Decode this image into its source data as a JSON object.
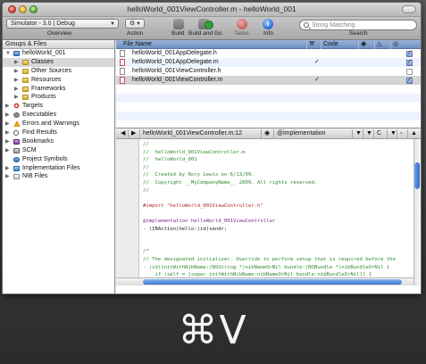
{
  "window": {
    "title": "helloWorld_001ViewController.m - helloWorld_001"
  },
  "toolbar": {
    "overview_value": "Simulator - 3.0 | Debug",
    "overview_label": "Overview",
    "action_label": "Action",
    "build_label": "Build",
    "build_go_label": "Build and Go",
    "tasks_label": "Tasks",
    "info_label": "Info",
    "info_glyph": "i",
    "search_placeholder": "String Matching",
    "search_label": "Search"
  },
  "sidebar": {
    "header": "Groups & Files",
    "items": [
      {
        "label": "helloWorld_001",
        "icon": "project-icon",
        "indent": 0,
        "expanded": true,
        "selected": false
      },
      {
        "label": "Classes",
        "icon": "folder-icon",
        "indent": 1,
        "expanded": false,
        "selected": true
      },
      {
        "label": "Other Sources",
        "icon": "folder-icon",
        "indent": 1,
        "expanded": false,
        "selected": false
      },
      {
        "label": "Resources",
        "icon": "folder-icon",
        "indent": 1,
        "expanded": false,
        "selected": false
      },
      {
        "label": "Frameworks",
        "icon": "folder-icon",
        "indent": 1,
        "expanded": false,
        "selected": false
      },
      {
        "label": "Products",
        "icon": "folder-icon",
        "indent": 1,
        "expanded": false,
        "selected": false
      },
      {
        "label": "Targets",
        "icon": "target-icon",
        "indent": 0,
        "expanded": false,
        "selected": false
      },
      {
        "label": "Executables",
        "icon": "gear-icon",
        "indent": 0,
        "expanded": false,
        "selected": false
      },
      {
        "label": "Errors and Warnings",
        "icon": "warning-icon",
        "indent": 0,
        "expanded": false,
        "selected": false
      },
      {
        "label": "Find Results",
        "icon": "find-icon",
        "indent": 0,
        "expanded": false,
        "selected": false
      },
      {
        "label": "Bookmarks",
        "icon": "bookmark-icon",
        "indent": 0,
        "expanded": false,
        "selected": false
      },
      {
        "label": "SCM",
        "icon": "scm-icon",
        "indent": 0,
        "expanded": false,
        "selected": false
      },
      {
        "label": "Project Symbols",
        "icon": "symbols-icon",
        "indent": 0,
        "expanded": null,
        "selected": false
      },
      {
        "label": "Implementation Files",
        "icon": "implementation-icon",
        "indent": 0,
        "expanded": false,
        "selected": false
      },
      {
        "label": "NIB Files",
        "icon": "nib-icon",
        "indent": 0,
        "expanded": false,
        "selected": false
      }
    ]
  },
  "detail": {
    "columns": [
      "File Name",
      "Code"
    ],
    "files": [
      {
        "name": "helloWorld_001AppDelegate.h",
        "code": false,
        "checked": true
      },
      {
        "name": "helloWorld_001AppDelegate.m",
        "code": true,
        "checked": true
      },
      {
        "name": "helloWorld_001ViewController.h",
        "code": false,
        "checked": false
      },
      {
        "name": "helloWorld_001ViewController.m",
        "code": true,
        "checked": true
      }
    ]
  },
  "editor": {
    "nav": {
      "file": "helloWorld_001ViewController.m:12",
      "symbol": "@implementation",
      "counterpart": "C"
    },
    "lines": [
      {
        "text": "//",
        "color": "green"
      },
      {
        "text": "//  helloWorld_001ViewController.m",
        "color": "green"
      },
      {
        "text": "//  helloWorld_001",
        "color": "green"
      },
      {
        "text": "//",
        "color": "green"
      },
      {
        "text": "//  Created by Rory Lewis on 6/13/09.",
        "color": "green"
      },
      {
        "text": "//  Copyright __MyCompanyName__ 2009. All rights reserved.",
        "color": "green"
      },
      {
        "text": "//",
        "color": "green"
      },
      {
        "text": "",
        "color": "plain"
      },
      {
        "text": "#import \"helloWorld_001ViewController.h\"",
        "color": "red"
      },
      {
        "text": "",
        "color": "plain"
      },
      {
        "text": "@implementation helloWorld_001ViewController",
        "color": "purple"
      },
      {
        "text": "- (IBAction)hello:(id)sendr;",
        "color": "plain"
      },
      {
        "text": "",
        "color": "plain"
      },
      {
        "text": "",
        "color": "plain"
      },
      {
        "text": "/*",
        "color": "green"
      },
      {
        "text": "// The designated initializer. Override to perform setup that is required before the",
        "color": "green"
      },
      {
        "text": "- (id)initWithNibName:(NSString *)nibNameOrNil bundle:(NSBundle *)nibBundleOrNil {",
        "color": "green"
      },
      {
        "text": "    if (self = [super initWithNibName:nibNameOrNil bundle:nibBundleOrNil]) {",
        "color": "green"
      }
    ]
  },
  "overlay": {
    "shortcut": "⌘V"
  },
  "colors": {
    "selection": "#d4d4d4",
    "header_blue": "#7f9bcb",
    "comment_green": "#2e8b2e",
    "string_red": "#b02626",
    "keyword_purple": "#7a2a8a"
  }
}
